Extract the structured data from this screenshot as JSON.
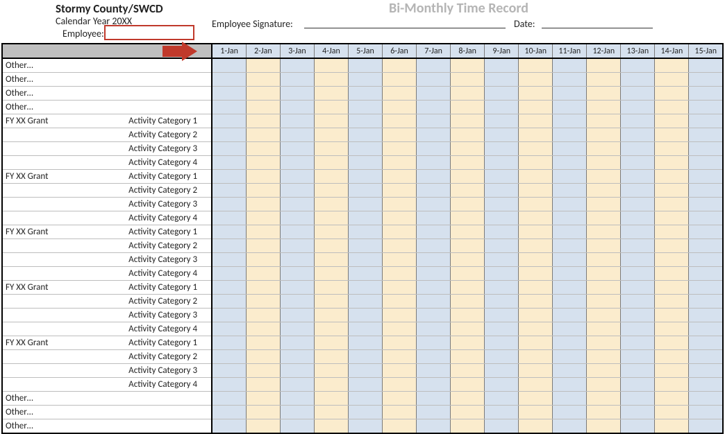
{
  "header": {
    "org": "Stormy County/SWCD",
    "calendar_year": "Calendar Year 20XX",
    "employee_label": "Employee:",
    "signature_label": "Employee Signature:",
    "date_label": "Date:",
    "title": "Bi-Monthly Time Record"
  },
  "dates": [
    "1-Jan",
    "2-Jan",
    "3-Jan",
    "4-Jan",
    "5-Jan",
    "6-Jan",
    "7-Jan",
    "8-Jan",
    "9-Jan",
    "10-Jan",
    "11-Jan",
    "12-Jan",
    "13-Jan",
    "14-Jan",
    "15-Jan"
  ],
  "rows": [
    {
      "grant": "Other…",
      "activity": ""
    },
    {
      "grant": "Other…",
      "activity": ""
    },
    {
      "grant": "Other…",
      "activity": ""
    },
    {
      "grant": "Other…",
      "activity": ""
    },
    {
      "grant": "FY XX Grant",
      "activity": "Activity Category 1"
    },
    {
      "grant": "",
      "activity": "Activity Category 2"
    },
    {
      "grant": "",
      "activity": "Activity Category 3"
    },
    {
      "grant": "",
      "activity": "Activity Category 4"
    },
    {
      "grant": "FY XX Grant",
      "activity": "Activity Category 1"
    },
    {
      "grant": "",
      "activity": "Activity Category 2"
    },
    {
      "grant": "",
      "activity": "Activity Category 3"
    },
    {
      "grant": "",
      "activity": "Activity Category 4"
    },
    {
      "grant": "FY XX Grant",
      "activity": "Activity Category 1"
    },
    {
      "grant": "",
      "activity": "Activity Category 2"
    },
    {
      "grant": "",
      "activity": "Activity Category 3"
    },
    {
      "grant": "",
      "activity": "Activity Category 4"
    },
    {
      "grant": "FY XX Grant",
      "activity": "Activity Category 1"
    },
    {
      "grant": "",
      "activity": "Activity Category 2"
    },
    {
      "grant": "",
      "activity": "Activity Category 3"
    },
    {
      "grant": "",
      "activity": "Activity Category 4"
    },
    {
      "grant": "FY XX Grant",
      "activity": "Activity Category 1"
    },
    {
      "grant": "",
      "activity": "Activity Category 2"
    },
    {
      "grant": "",
      "activity": "Activity Category 3"
    },
    {
      "grant": "",
      "activity": "Activity Category 4"
    },
    {
      "grant": "Other…",
      "activity": ""
    },
    {
      "grant": "Other…",
      "activity": ""
    },
    {
      "grant": "Other…",
      "activity": ""
    }
  ]
}
